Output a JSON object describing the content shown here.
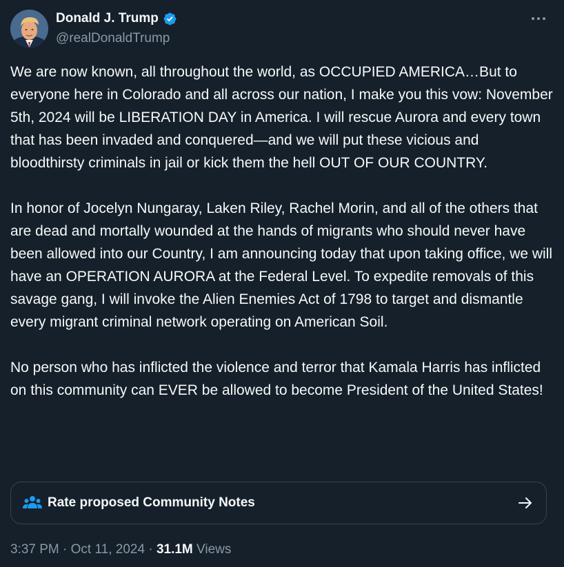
{
  "author": {
    "display_name": "Donald J. Trump",
    "handle": "@realDonaldTrump",
    "verified": true
  },
  "more_icon": "···",
  "tweet": {
    "paragraphs": [
      "We are now known, all throughout the world, as OCCUPIED AMERICA…But to everyone here in Colorado and all across our nation, I make you this vow: November 5th, 2024 will be LIBERATION DAY in America. I will rescue Aurora and every town that has been invaded and conquered—and we will put these vicious and bloodthirsty criminals in jail or kick them the hell OUT OF OUR COUNTRY.",
      "In honor of Jocelyn Nungaray, Laken Riley, Rachel Morin, and all of the others that are dead and mortally wounded at the hands of migrants who should never have been allowed into our Country, I am announcing today that upon taking office, we will have an OPERATION AURORA at the Federal Level. To expedite removals of this savage gang, I will invoke the Alien Enemies Act of 1798 to target and dismantle every migrant criminal network operating on American Soil.",
      "No person who has inflicted the violence and terror that Kamala Harris has inflicted on this community can EVER be allowed to become President of the United States!"
    ]
  },
  "community_notes": {
    "label": "Rate proposed Community Notes",
    "icon": "people-icon",
    "arrow_icon": "arrow-right-icon"
  },
  "meta": {
    "time": "3:37 PM",
    "separator": " · ",
    "date": "Oct 11, 2024",
    "views_count": "31.1M",
    "views_label": " Views"
  },
  "colors": {
    "background": "#15202b",
    "text": "#f7f9f9",
    "secondary": "#8b98a5",
    "verified": "#1d9bf0",
    "border": "#38444d"
  }
}
